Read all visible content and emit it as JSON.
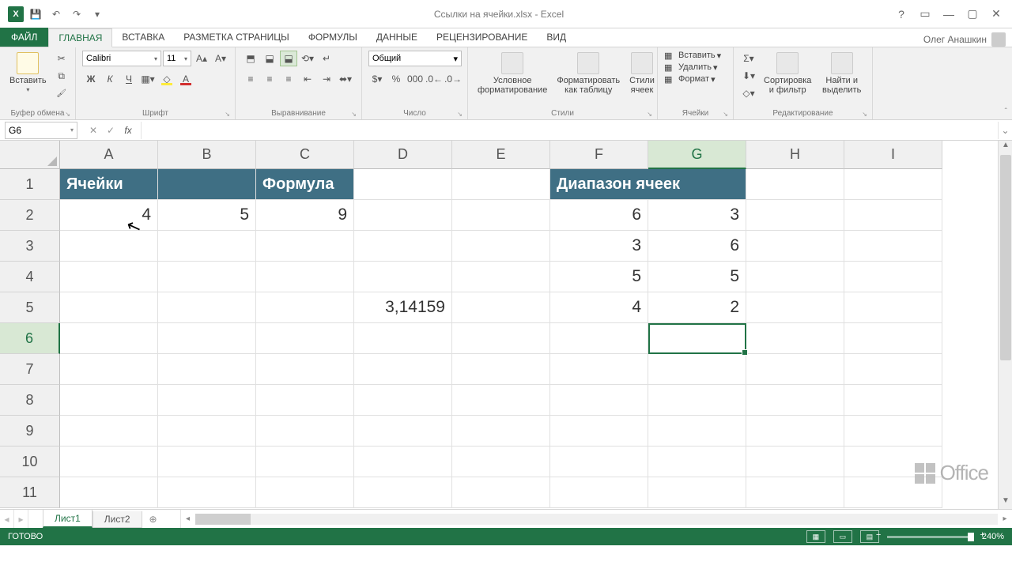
{
  "titlebar": {
    "title": "Ссылки на ячейки.xlsx - Excel"
  },
  "qat": {
    "save": "💾",
    "undo": "↶",
    "redo": "↷",
    "custom": "▾"
  },
  "win": {
    "help": "?",
    "opts": "▭",
    "min": "—",
    "max": "▢",
    "close": "✕"
  },
  "user": {
    "name": "Олег Анашкин"
  },
  "tabs": {
    "file": "ФАЙЛ",
    "items": [
      "ГЛАВНАЯ",
      "ВСТАВКА",
      "РАЗМЕТКА СТРАНИЦЫ",
      "ФОРМУЛЫ",
      "ДАННЫЕ",
      "РЕЦЕНЗИРОВАНИЕ",
      "ВИД"
    ],
    "active_index": 0
  },
  "ribbon": {
    "clipboard": {
      "paste": "Вставить",
      "label": "Буфер обмена"
    },
    "font": {
      "name": "Calibri",
      "size": "11",
      "label": "Шрифт",
      "bold": "Ж",
      "italic": "К",
      "underline": "Ч"
    },
    "align": {
      "label": "Выравнивание"
    },
    "number": {
      "format": "Общий",
      "label": "Число"
    },
    "styles": {
      "cond": "Условное форматирование",
      "table": "Форматировать как таблицу",
      "cell": "Стили ячеек",
      "label": "Стили"
    },
    "cells": {
      "insert": "Вставить",
      "delete": "Удалить",
      "format": "Формат",
      "label": "Ячейки"
    },
    "edit": {
      "sort": "Сортировка и фильтр",
      "find": "Найти и выделить",
      "label": "Редактирование"
    }
  },
  "namebox": {
    "ref": "G6"
  },
  "columns": [
    "A",
    "B",
    "C",
    "D",
    "E",
    "F",
    "G",
    "H",
    "I"
  ],
  "rows": [
    "1",
    "2",
    "3",
    "4",
    "5",
    "6",
    "7",
    "8",
    "9",
    "10",
    "11"
  ],
  "active": {
    "col": "G",
    "row": "6"
  },
  "cells": {
    "A1": "Ячейки",
    "C1": "Формула",
    "A2": "4",
    "B2": "5",
    "C2": "9",
    "D5": "3,14159",
    "F1": "Диапазон ячеек",
    "F2": "6",
    "G2": "3",
    "F3": "3",
    "G3": "6",
    "F4": "5",
    "G4": "5",
    "F5": "4",
    "G5": "2"
  },
  "sheets": {
    "items": [
      "Лист1",
      "Лист2"
    ],
    "active_index": 0,
    "add": "⊕"
  },
  "status": {
    "ready": "ГОТОВО",
    "zoom": "240%"
  },
  "chart_data": {
    "type": "table",
    "sheets": [
      "Лист1",
      "Лист2"
    ],
    "active_sheet": "Лист1",
    "selected_cell": "G6",
    "headers": {
      "A1": "Ячейки",
      "C1": "Формула",
      "F1:G1": "Диапазон ячеек"
    },
    "data": {
      "A2": 4,
      "B2": 5,
      "C2": 9,
      "D5": "3,14159",
      "F2": 6,
      "G2": 3,
      "F3": 3,
      "G3": 6,
      "F4": 5,
      "G4": 5,
      "F5": 4,
      "G5": 2
    }
  }
}
